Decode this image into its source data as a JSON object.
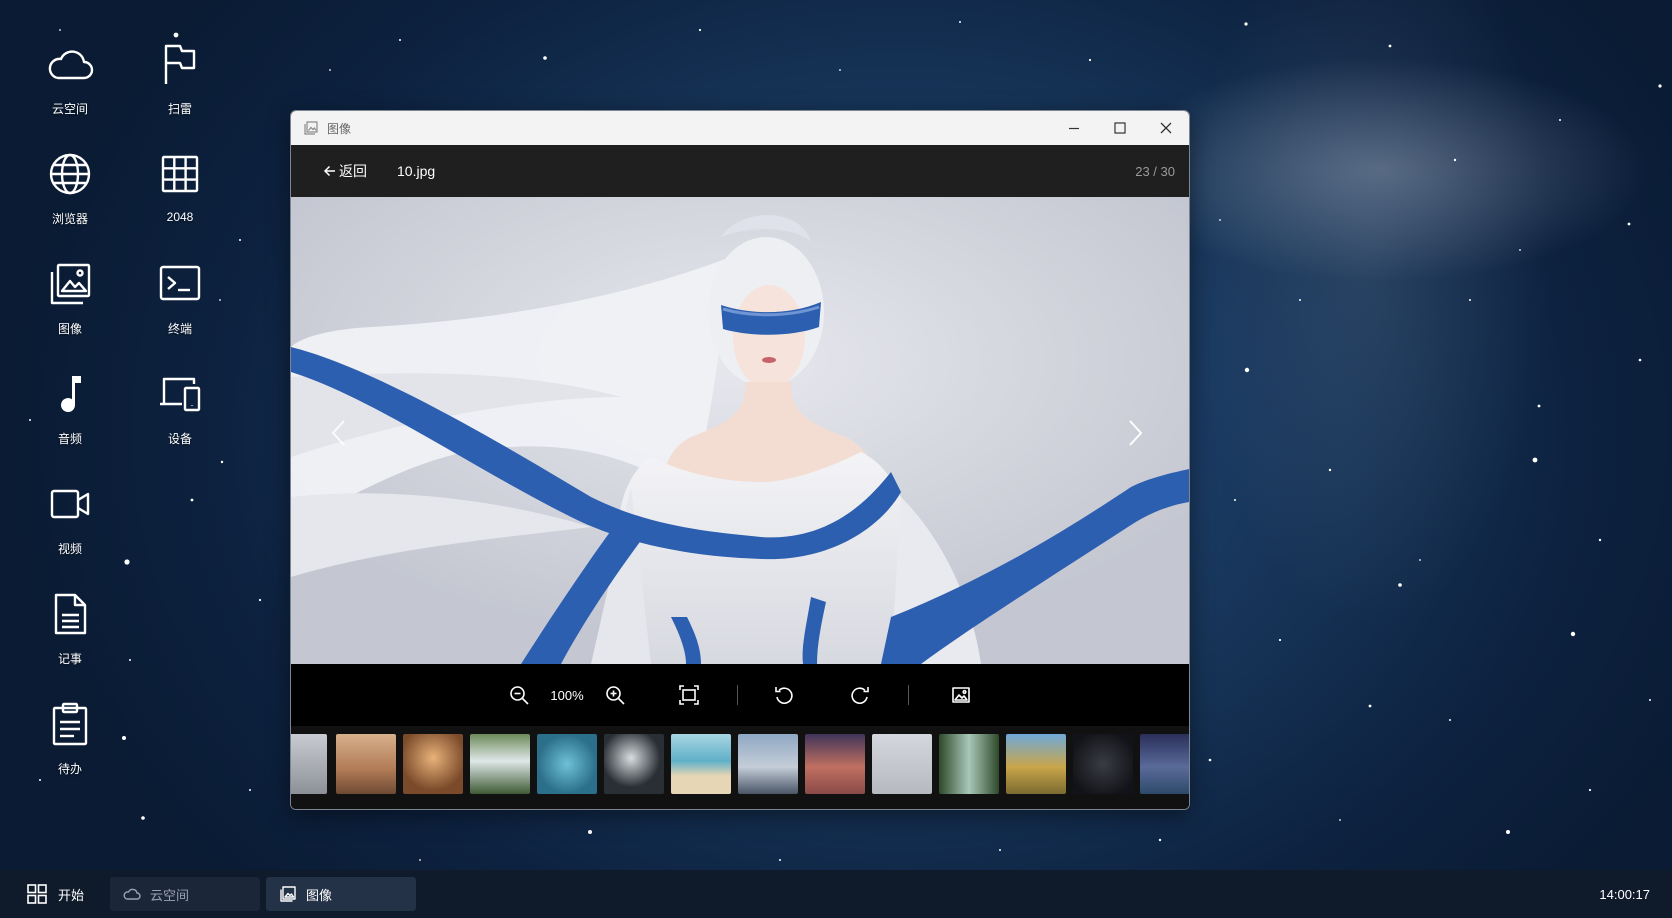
{
  "desktop": {
    "icons": [
      {
        "label": "云空间",
        "icon": "cloud-icon"
      },
      {
        "label": "扫雷",
        "icon": "flag-icon"
      },
      {
        "label": "浏览器",
        "icon": "globe-icon"
      },
      {
        "label": "2048",
        "icon": "grid-icon"
      },
      {
        "label": "图像",
        "icon": "gallery-icon"
      },
      {
        "label": "终端",
        "icon": "terminal-icon"
      },
      {
        "label": "音频",
        "icon": "music-note-icon"
      },
      {
        "label": "设备",
        "icon": "devices-icon"
      },
      {
        "label": "视频",
        "icon": "video-camera-icon"
      },
      {
        "label": "记事",
        "icon": "document-icon"
      },
      {
        "label": "待办",
        "icon": "clipboard-icon"
      }
    ]
  },
  "window": {
    "title": "图像",
    "back_label": "返回",
    "file_name": "10.jpg",
    "counter": "23 / 30",
    "zoom": "100%",
    "thumbnail_count": 14,
    "colors": {
      "titlebar": "#f3f3f3",
      "header": "#1f1f1f",
      "toolbar": "#000000",
      "ribbon_blue": "#2d5fb0"
    }
  },
  "taskbar": {
    "start_label": "开始",
    "tasks": [
      {
        "label": "云空间",
        "icon": "cloud-icon"
      },
      {
        "label": "图像",
        "icon": "gallery-icon"
      }
    ],
    "clock": "14:00:17"
  }
}
